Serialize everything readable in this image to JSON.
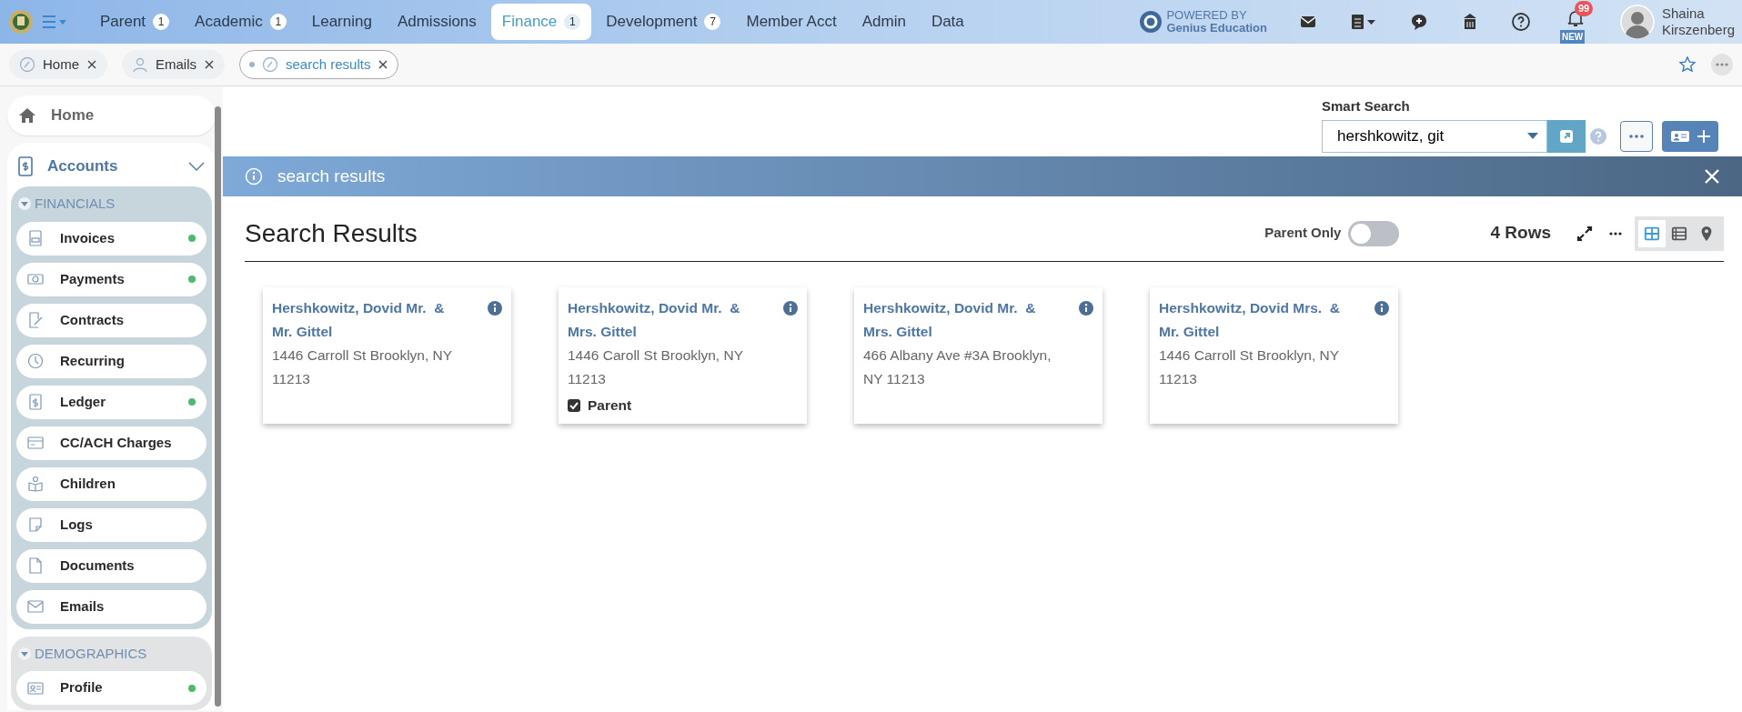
{
  "top_nav": [
    {
      "label": "Parent",
      "count": "1",
      "selected": false
    },
    {
      "label": "Academic",
      "count": "1",
      "selected": false
    },
    {
      "label": "Learning",
      "selected": false
    },
    {
      "label": "Admissions",
      "selected": false
    },
    {
      "label": "Finance",
      "count": "1",
      "selected": true
    },
    {
      "label": "Development",
      "count": "7",
      "selected": false
    },
    {
      "label": "Member Acct",
      "selected": false
    },
    {
      "label": "Admin",
      "selected": false
    },
    {
      "label": "Data",
      "selected": false
    }
  ],
  "powered_by": {
    "line1": "POWERED BY",
    "line2": "Genius Education"
  },
  "notifications": {
    "count": "99",
    "tag": "NEW"
  },
  "user": {
    "name_lines": [
      "Shaina",
      "Kirszenberg"
    ]
  },
  "open_tabs": [
    {
      "label": "Home",
      "selected": false
    },
    {
      "label": "Emails",
      "selected": false
    },
    {
      "label": "search results",
      "selected": true
    }
  ],
  "sidebar": {
    "home": "Home",
    "section": {
      "title": "Accounts",
      "expanded": true
    },
    "groups": [
      {
        "title": "FINANCIALS",
        "expanded": true,
        "items": [
          {
            "label": "Invoices",
            "indicator": true
          },
          {
            "label": "Payments",
            "indicator": true
          },
          {
            "label": "Contracts",
            "indicator": false
          },
          {
            "label": "Recurring",
            "indicator": false
          },
          {
            "label": "Ledger",
            "indicator": true
          },
          {
            "label": "CC/ACH Charges",
            "indicator": false
          },
          {
            "label": "Children",
            "indicator": false
          },
          {
            "label": "Logs",
            "indicator": false
          },
          {
            "label": "Documents",
            "indicator": false
          },
          {
            "label": "Emails",
            "indicator": false
          }
        ]
      },
      {
        "title": "DEMOGRAPHICS",
        "expanded": true,
        "items": [
          {
            "label": "Profile",
            "indicator": true
          }
        ]
      }
    ]
  },
  "smart_search": {
    "label": "Smart Search",
    "value": "hershkowitz, git"
  },
  "banner": {
    "title": "search results"
  },
  "results": {
    "title": "Search Results",
    "toggle": {
      "label": "Parent Only",
      "on": false
    },
    "row_count": "4 Rows",
    "views": [
      {
        "selected": true
      },
      {
        "selected": false
      },
      {
        "selected": false
      }
    ],
    "cards": [
      {
        "name": "Hershkowitz, Dovid Mr.  &  Mr. Gittel",
        "address": "1446 Carroll St Brooklyn, NY 11213"
      },
      {
        "name": "Hershkowitz, Dovid Mr.  &  Mrs. Gittel",
        "address": "1446 Caroll St Brooklyn, NY 11213",
        "flag": {
          "label": "Parent",
          "checked": true
        }
      },
      {
        "name": "Hershkowitz, Dovid Mr.  &  Mrs. Gittel",
        "address": "466 Albany Ave #3A Brooklyn, NY 11213"
      },
      {
        "name": "Hershkowitz, Dovid Mrs.  &  Mr. Gittel",
        "address": "1446 Carroll St Brooklyn, NY 11213"
      }
    ]
  }
}
